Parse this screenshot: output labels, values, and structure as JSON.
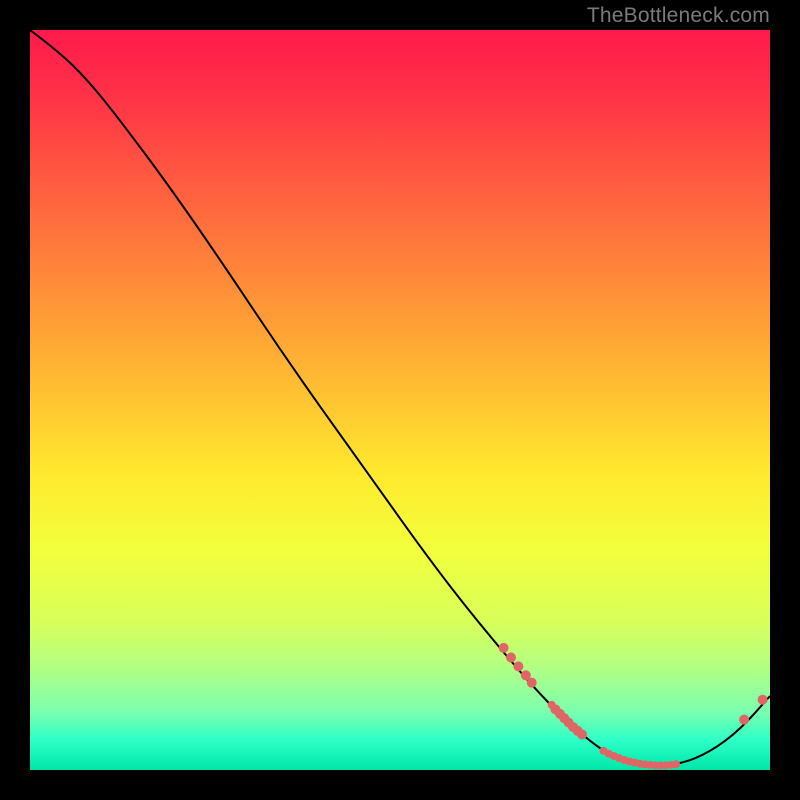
{
  "watermark": "TheBottleneck.com",
  "colors": {
    "page_bg": "#000000",
    "curve_stroke": "#000000",
    "dot_fill": "#e06666",
    "gradient_stops": [
      "#ff1a4b",
      "#ff2f47",
      "#ff6b3e",
      "#ffb233",
      "#ffe92e",
      "#f2ff3c",
      "#d8ff5a",
      "#b2ff82",
      "#7dffae",
      "#2dffc7",
      "#00e6a8"
    ]
  },
  "chart_data": {
    "type": "line",
    "title": "",
    "xlabel": "",
    "ylabel": "",
    "xlim": [
      0,
      100
    ],
    "ylim": [
      0,
      100
    ],
    "grid": false,
    "curve": [
      {
        "x": 0,
        "y": 100
      },
      {
        "x": 4,
        "y": 97
      },
      {
        "x": 8,
        "y": 93
      },
      {
        "x": 12,
        "y": 88
      },
      {
        "x": 18,
        "y": 80
      },
      {
        "x": 25,
        "y": 70
      },
      {
        "x": 35,
        "y": 55
      },
      {
        "x": 45,
        "y": 41
      },
      {
        "x": 55,
        "y": 27
      },
      {
        "x": 63,
        "y": 17
      },
      {
        "x": 70,
        "y": 9
      },
      {
        "x": 76,
        "y": 3.5
      },
      {
        "x": 80,
        "y": 1.2
      },
      {
        "x": 84,
        "y": 0.6
      },
      {
        "x": 88,
        "y": 0.8
      },
      {
        "x": 92,
        "y": 2.5
      },
      {
        "x": 96,
        "y": 5.5
      },
      {
        "x": 100,
        "y": 10
      }
    ],
    "dots_cluster_a": [
      {
        "x": 64,
        "y": 16.5,
        "r": 5
      },
      {
        "x": 65,
        "y": 15.2,
        "r": 5
      },
      {
        "x": 66,
        "y": 14.0,
        "r": 5
      },
      {
        "x": 67,
        "y": 12.8,
        "r": 5
      },
      {
        "x": 67.8,
        "y": 11.8,
        "r": 5
      }
    ],
    "dots_cluster_b": [
      {
        "x": 70.5,
        "y": 8.8,
        "r": 4
      },
      {
        "x": 71,
        "y": 8.2,
        "r": 5
      },
      {
        "x": 71.6,
        "y": 7.6,
        "r": 5
      },
      {
        "x": 72.2,
        "y": 7.0,
        "r": 5
      },
      {
        "x": 72.8,
        "y": 6.4,
        "r": 5
      },
      {
        "x": 73.4,
        "y": 5.8,
        "r": 5
      },
      {
        "x": 74.0,
        "y": 5.3,
        "r": 5
      },
      {
        "x": 74.6,
        "y": 4.8,
        "r": 5
      }
    ],
    "dots_valley": [
      {
        "x": 77.5,
        "y": 2.6,
        "r": 4
      },
      {
        "x": 78.2,
        "y": 2.2,
        "r": 4
      },
      {
        "x": 78.9,
        "y": 1.9,
        "r": 4
      },
      {
        "x": 79.6,
        "y": 1.6,
        "r": 4
      },
      {
        "x": 80.3,
        "y": 1.35,
        "r": 4
      },
      {
        "x": 81.0,
        "y": 1.15,
        "r": 4
      },
      {
        "x": 81.7,
        "y": 1.0,
        "r": 4
      },
      {
        "x": 82.4,
        "y": 0.85,
        "r": 4
      },
      {
        "x": 83.1,
        "y": 0.75,
        "r": 4
      },
      {
        "x": 83.8,
        "y": 0.68,
        "r": 4
      },
      {
        "x": 84.5,
        "y": 0.62,
        "r": 4
      },
      {
        "x": 85.2,
        "y": 0.6,
        "r": 4
      },
      {
        "x": 85.9,
        "y": 0.62,
        "r": 4
      },
      {
        "x": 86.6,
        "y": 0.68,
        "r": 4
      },
      {
        "x": 87.3,
        "y": 0.78,
        "r": 4
      }
    ],
    "dots_tail": [
      {
        "x": 96.5,
        "y": 6.8,
        "r": 5
      },
      {
        "x": 99.0,
        "y": 9.5,
        "r": 5
      }
    ]
  }
}
